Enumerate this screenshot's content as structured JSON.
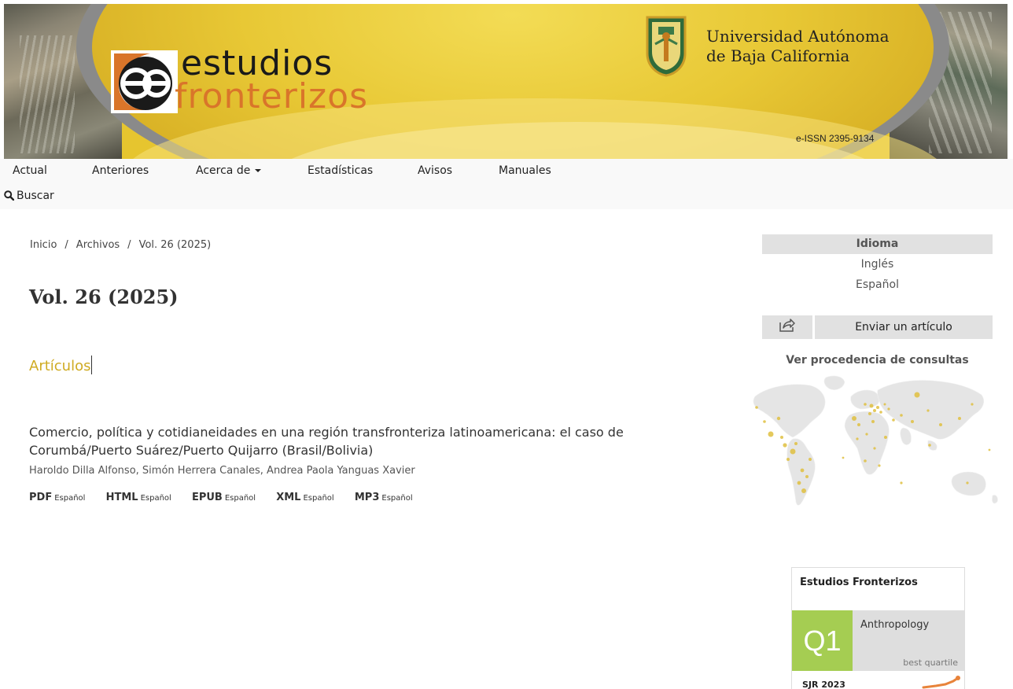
{
  "header": {
    "logo_word_1": "estudios",
    "logo_word_2": "fronterizos",
    "university_line_1": "Universidad Autónoma",
    "university_line_2": "de Baja California",
    "issn": "e-ISSN  2395-9134"
  },
  "nav": {
    "items": [
      "Actual",
      "Anteriores",
      "Acerca de",
      "Estadísticas",
      "Avisos",
      "Manuales"
    ],
    "search_label": "Buscar"
  },
  "breadcrumb": [
    "Inicio",
    "Archivos",
    "Vol. 26 (2025)"
  ],
  "issue_title": "Vol. 26 (2025)",
  "section_title": "Artículos",
  "article": {
    "title": "Comercio, política y cotidianeidades en una región transfronteriza latinoamericana: el caso de Corumbá/Puerto Suárez/Puerto Quijarro (Brasil/Bolivia)",
    "authors": "Haroldo Dilla Alfonso, Simón Herrera Canales, Andrea Paola Yanguas Xavier",
    "galleys": [
      {
        "format": "PDF",
        "lang": "Español"
      },
      {
        "format": "HTML",
        "lang": "Español"
      },
      {
        "format": "EPUB",
        "lang": "Español"
      },
      {
        "format": "XML",
        "lang": "Español"
      },
      {
        "format": "MP3",
        "lang": "Español"
      }
    ]
  },
  "sidebar": {
    "language_heading": "Idioma",
    "languages": [
      "Inglés",
      "Español"
    ],
    "submit_label": "Enviar un artículo",
    "map_title": "Ver procedencia de consultas",
    "sjr": {
      "journal": "Estudios Fronterizos",
      "quartile": "Q1",
      "category": "Anthropology",
      "best_label": "best quartile",
      "year_label": "SJR 2023"
    }
  },
  "colors": {
    "accent": "#cfab22",
    "logo_orange": "#d9752a",
    "sjr_green": "#a5cd52",
    "sidebar_grey": "#e1e1e1"
  }
}
